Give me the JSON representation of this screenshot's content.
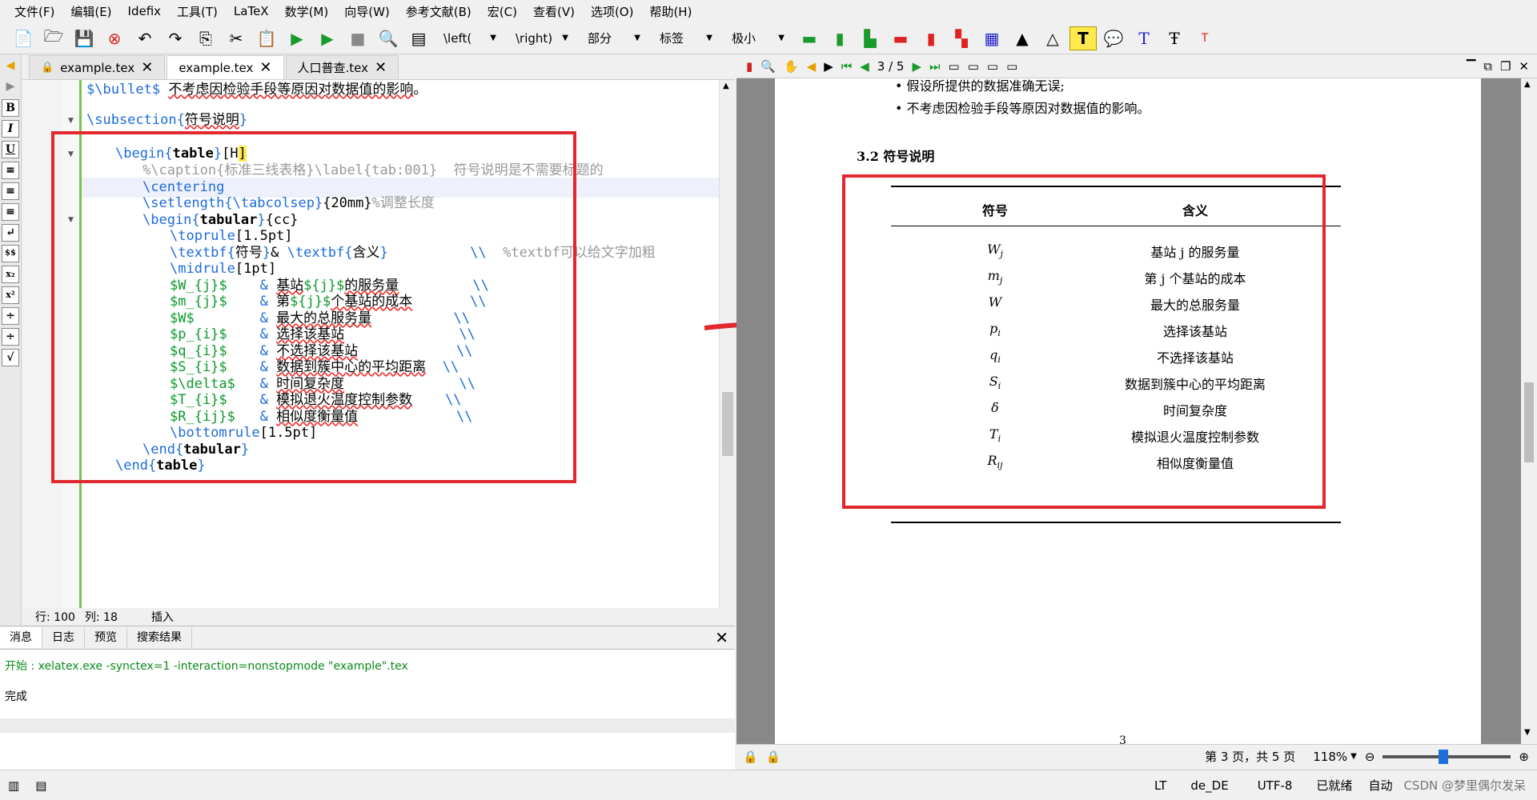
{
  "menu": [
    "文件(F)",
    "编辑(E)",
    "Idefix",
    "工具(T)",
    "LaTeX",
    "数学(M)",
    "向导(W)",
    "参考文献(B)",
    "宏(C)",
    "查看(V)",
    "选项(O)",
    "帮助(H)"
  ],
  "toolbar": {
    "left_delim": "\\left(",
    "right_delim": "\\right)",
    "section": "部分",
    "label": "标签",
    "size": "极小"
  },
  "tabs": [
    "example.tex",
    "example.tex",
    "人口普查.tex"
  ],
  "editor": {
    "lines": [
      {
        "text": "$\\bullet$ 不考虑因检验手段等原因对数据值的影响。"
      },
      {
        "text": "\\subsection{符号说明}"
      },
      {
        "text": "\\begin{table}[H]"
      },
      {
        "text": "%\\caption{标准三线表格}\\label{tab:001}  符号说明是不需要标题的"
      },
      {
        "text": "\\centering"
      },
      {
        "text": "\\setlength{\\tabcolsep}{20mm}%调整长度"
      },
      {
        "text": "\\begin{tabular}{cc}"
      },
      {
        "text": "\\toprule[1.5pt]"
      },
      {
        "text": "\\textbf{符号}& \\textbf{含义}          \\\\  %textbf可以给文字加粗"
      },
      {
        "text": "\\midrule[1pt]"
      },
      {
        "text": "$W_{j}$    & 基站${j}$的服务量         \\\\"
      },
      {
        "text": "$m_{j}$    & 第${j}$个基站的成本       \\\\"
      },
      {
        "text": "$W$        & 最大的总服务量            \\\\"
      },
      {
        "text": "$p_{i}$    & 选择该基站                \\\\"
      },
      {
        "text": "$q_{i}$    & 不选择该基站              \\\\"
      },
      {
        "text": "$S_{i}$    & 数据到簇中心的平均距离    \\\\"
      },
      {
        "text": "$\\delta$   & 时间复杂度                \\\\"
      },
      {
        "text": "$T_{i}$    & 模拟退火温度控制参数      \\\\"
      },
      {
        "text": "$R_{ij}$   & 相似度衡量值              \\\\"
      },
      {
        "text": "\\bottomrule[1.5pt]"
      },
      {
        "text": "\\end{tabular}"
      },
      {
        "text": "\\end{table}"
      }
    ],
    "status_row": "行:  100",
    "status_col": "列:  18",
    "status_mode": "插入"
  },
  "panel": {
    "tabs": [
      "消息",
      "日志",
      "预览",
      "搜索结果"
    ],
    "line1": "开始 : xelatex.exe -synctex=1 -interaction=nonstopmode \"example\".tex",
    "line2": "完成"
  },
  "pdf": {
    "page_nav": "3 / 5",
    "bullet1": "• 假设所提供的数据准确无误;",
    "bullet2": "• 不考虑因检验手段等原因对数据值的影响。",
    "section": "3.2 符号说明",
    "header_sym": "符号",
    "header_mean": "含义",
    "rows": [
      {
        "sym": "W",
        "sub": "j",
        "mean": "基站 j 的服务量"
      },
      {
        "sym": "m",
        "sub": "j",
        "mean": "第 j 个基站的成本"
      },
      {
        "sym": "W",
        "sub": "",
        "mean": "最大的总服务量"
      },
      {
        "sym": "p",
        "sub": "i",
        "mean": "选择该基站"
      },
      {
        "sym": "q",
        "sub": "i",
        "mean": "不选择该基站"
      },
      {
        "sym": "S",
        "sub": "i",
        "mean": "数据到簇中心的平均距离"
      },
      {
        "sym": "δ",
        "sub": "",
        "mean": "时间复杂度"
      },
      {
        "sym": "T",
        "sub": "i",
        "mean": "模拟退火温度控制参数"
      },
      {
        "sym": "R",
        "sub": "ij",
        "mean": "相似度衡量值"
      }
    ],
    "page_number": "3",
    "status_pages": "第 3 页，共 5 页",
    "zoom": "118%"
  },
  "bottom": {
    "lang": "de_DE",
    "encoding": "UTF-8",
    "state": "已就绪",
    "mode": "自动",
    "watermark": "CSDN @梦里偶尔发呆"
  },
  "colors": {
    "accent": "#e0282e",
    "fold": "#7cc34c",
    "cmd": "#1c6cdb",
    "comment": "#999999",
    "math": "#0a9a2a"
  }
}
